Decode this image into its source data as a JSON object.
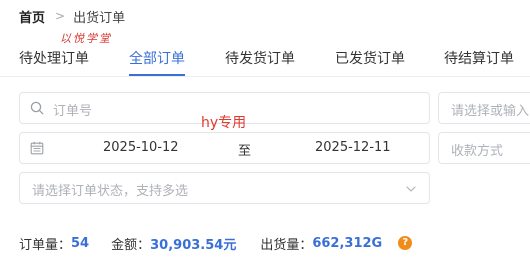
{
  "breadcrumb": {
    "home": "首页",
    "separator": ">",
    "current": "出货订单"
  },
  "watermark": {
    "script_text": "以悦学堂"
  },
  "tabs": [
    {
      "label": "待处理订单",
      "active": false
    },
    {
      "label": "全部订单",
      "active": true
    },
    {
      "label": "待发货订单",
      "active": false
    },
    {
      "label": "已发货订单",
      "active": false
    },
    {
      "label": "待结算订单",
      "active": false
    }
  ],
  "filters": {
    "order_no_placeholder": "订单号",
    "right_select_placeholder": "请选择或输入",
    "overlay_label": "hy专用",
    "date_start": "2025-10-12",
    "date_to": "至",
    "date_end": "2025-12-11",
    "payment_placeholder": "收款方式",
    "status_placeholder": "请选择订单状态，支持多选"
  },
  "summary": {
    "order_count_label": "订单量：",
    "order_count": "54",
    "amount_label": "金额：",
    "amount": "30,903.54元",
    "shipment_label": "出货量：",
    "shipment": "662,312G",
    "help_symbol": "?"
  },
  "colors": {
    "accent": "#3a6fd8",
    "help": "#f08c1a",
    "red_label": "#e0392e"
  },
  "icons": {
    "search": "search-icon",
    "calendar": "calendar-icon",
    "chevron": "chevron-down-icon",
    "help": "help-icon"
  }
}
